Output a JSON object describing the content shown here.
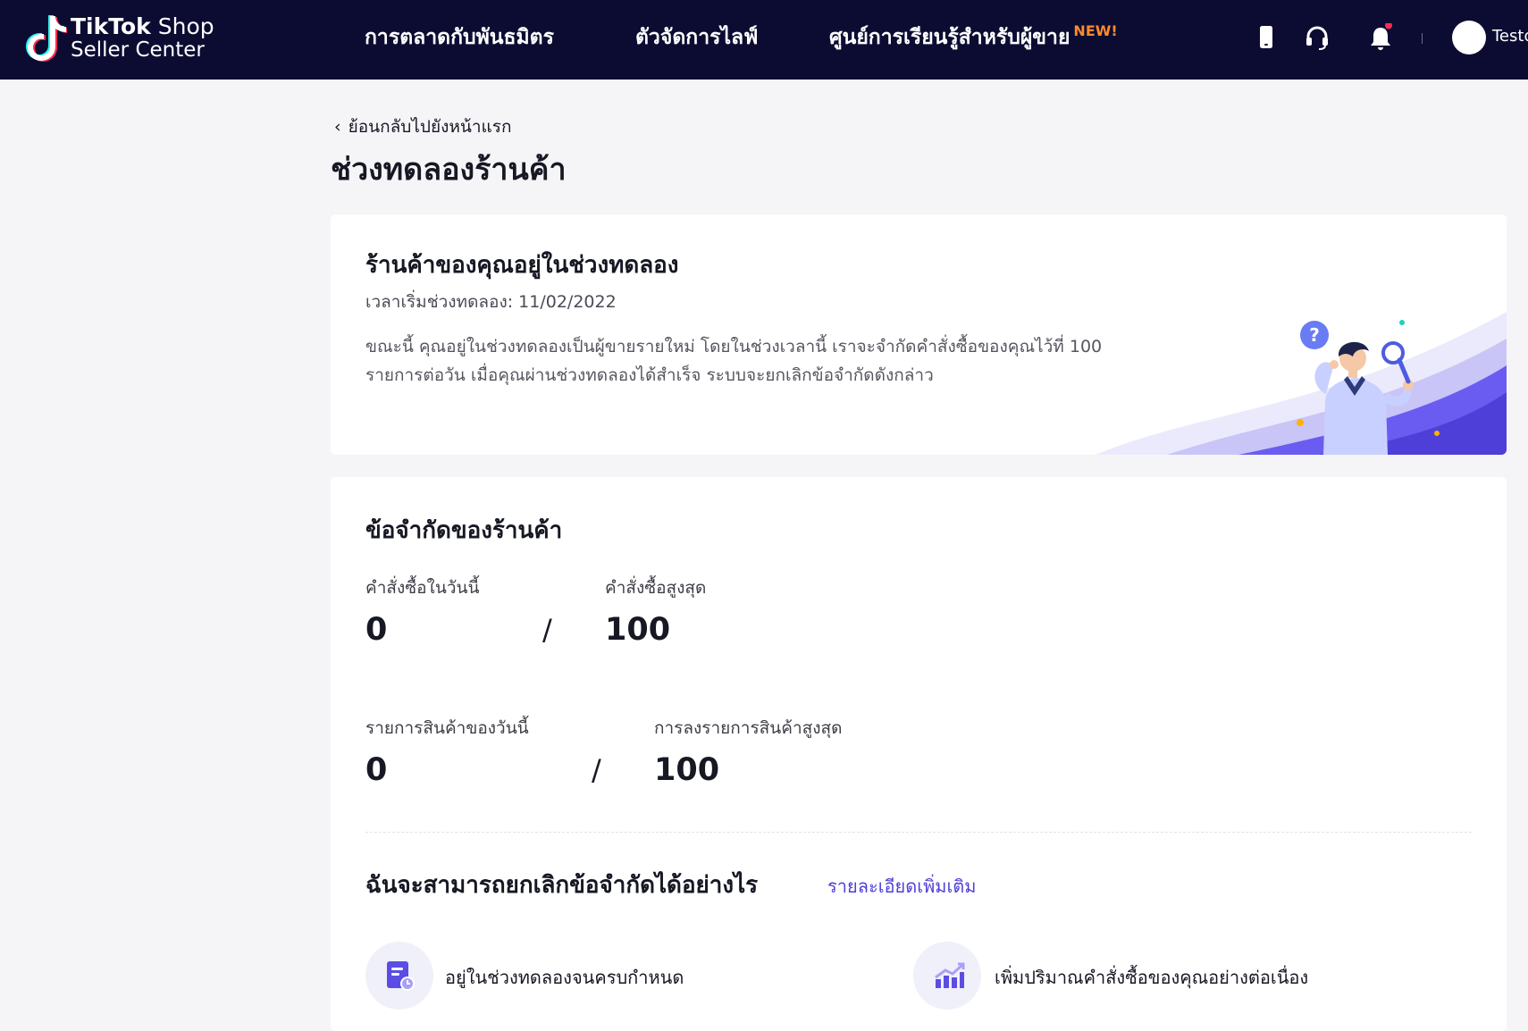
{
  "topbar": {
    "logo_line1_bold": "TikTok",
    "logo_line1_rest": " Shop",
    "logo_line2": "Seller Center",
    "nav": [
      {
        "label": "การตลาดกับพันธมิตร"
      },
      {
        "label": "ตัวจัดการไลฟ์"
      },
      {
        "label": "ศูนย์การเรียนรู้สำหรับผู้ขาย",
        "badge": "NEW!"
      }
    ],
    "icons": [
      "mobile-icon",
      "headset-icon",
      "bell-icon"
    ],
    "notification_dot_color": "#fe2c55",
    "user_name": "Testo"
  },
  "header": {
    "back_label": "ย้อนกลับไปยังหน้าแรก",
    "title": "ช่วงทดลองร้านค้า"
  },
  "trial_card": {
    "title": "ร้านค้าของคุณอยู่ในช่วงทดลอง",
    "start_label": "เวลาเริ่มช่วงทดลอง: 11/02/2022",
    "description": "ขณะนี้ คุณอยู่ในช่วงทดลองเป็นผู้ขายรายใหม่ โดยในช่วงเวลานี้ เราจะจำกัดคำสั่งซื้อของคุณไว้ที่ 100 รายการต่อวัน เมื่อคุณผ่านช่วงทดลองได้สำเร็จ ระบบจะยกเลิกข้อจำกัดดังกล่าว"
  },
  "limits_card": {
    "title": "ข้อจำกัดของร้านค้า",
    "orders_today_label": "คำสั่งซื้อในวันนี้",
    "orders_today_value": "0",
    "orders_max_label": "คำสั่งซื้อสูงสุด",
    "orders_max_value": "100",
    "listings_today_label": "รายการสินค้าของวันนี้",
    "listings_today_value": "0",
    "listings_max_label": "การลงรายการสินค้าสูงสุด",
    "listings_max_value": "100",
    "separator": "/",
    "how_title": "ฉันจะสามารถยกเลิกข้อจำกัดได้อย่างไร",
    "more_link": "รายละเอียดเพิ่มเติม",
    "steps": [
      {
        "icon": "document-clock-icon",
        "label": "อยู่ในช่วงทดลองจนครบกำหนด"
      },
      {
        "icon": "bar-chart-icon",
        "label": "เพิ่มปริมาณคำสั่งซื้อของคุณอย่างต่อเนื่อง"
      }
    ]
  },
  "colors": {
    "topbar_bg": "#0c0c33",
    "accent": "#4e3fd9",
    "new_badge": "#fe8a2d",
    "page_bg": "#f5f5f8"
  }
}
